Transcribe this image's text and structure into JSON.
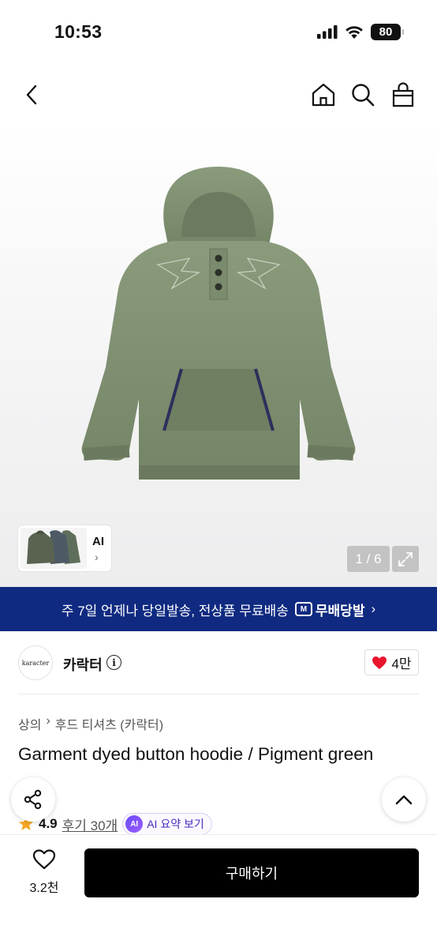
{
  "status_bar": {
    "time": "10:53",
    "battery": "80"
  },
  "gallery": {
    "thumb_label": "AI",
    "thumb_chevron": "›",
    "counter": "1 / 6"
  },
  "shipping": {
    "text": "주 7일 언제나 당일발송, 전상품 무료배송",
    "logo_mark": "M",
    "logo_text": "무배당발",
    "chevron": "›"
  },
  "brand": {
    "logo_text": "karacter",
    "name": "카락터",
    "info": "i",
    "likes": "4만"
  },
  "breadcrumb": {
    "category": "상의",
    "separator": "›",
    "subcategory": "후드 티셔츠 (카락터)"
  },
  "product": {
    "title": "Garment dyed button hoodie / Pigment green"
  },
  "rating": {
    "value": "4.9",
    "reviews": "후기 30개",
    "ai_badge": "AI",
    "ai_summary": "AI 요약 보기"
  },
  "bottom": {
    "wish_count": "3.2천",
    "buy_label": "구매하기"
  },
  "colors": {
    "banner": "#0f2a80",
    "heart": "#e8152d",
    "star": "#f5a623",
    "ai_purple": "#5b3cf0",
    "hoodie": "#7f8f72"
  },
  "icons": [
    "signal-icon",
    "wifi-icon",
    "back-icon",
    "home-icon",
    "search-icon",
    "bag-icon",
    "expand-icon",
    "info-icon",
    "heart-icon",
    "star-icon",
    "share-icon",
    "chevron-up-icon"
  ]
}
